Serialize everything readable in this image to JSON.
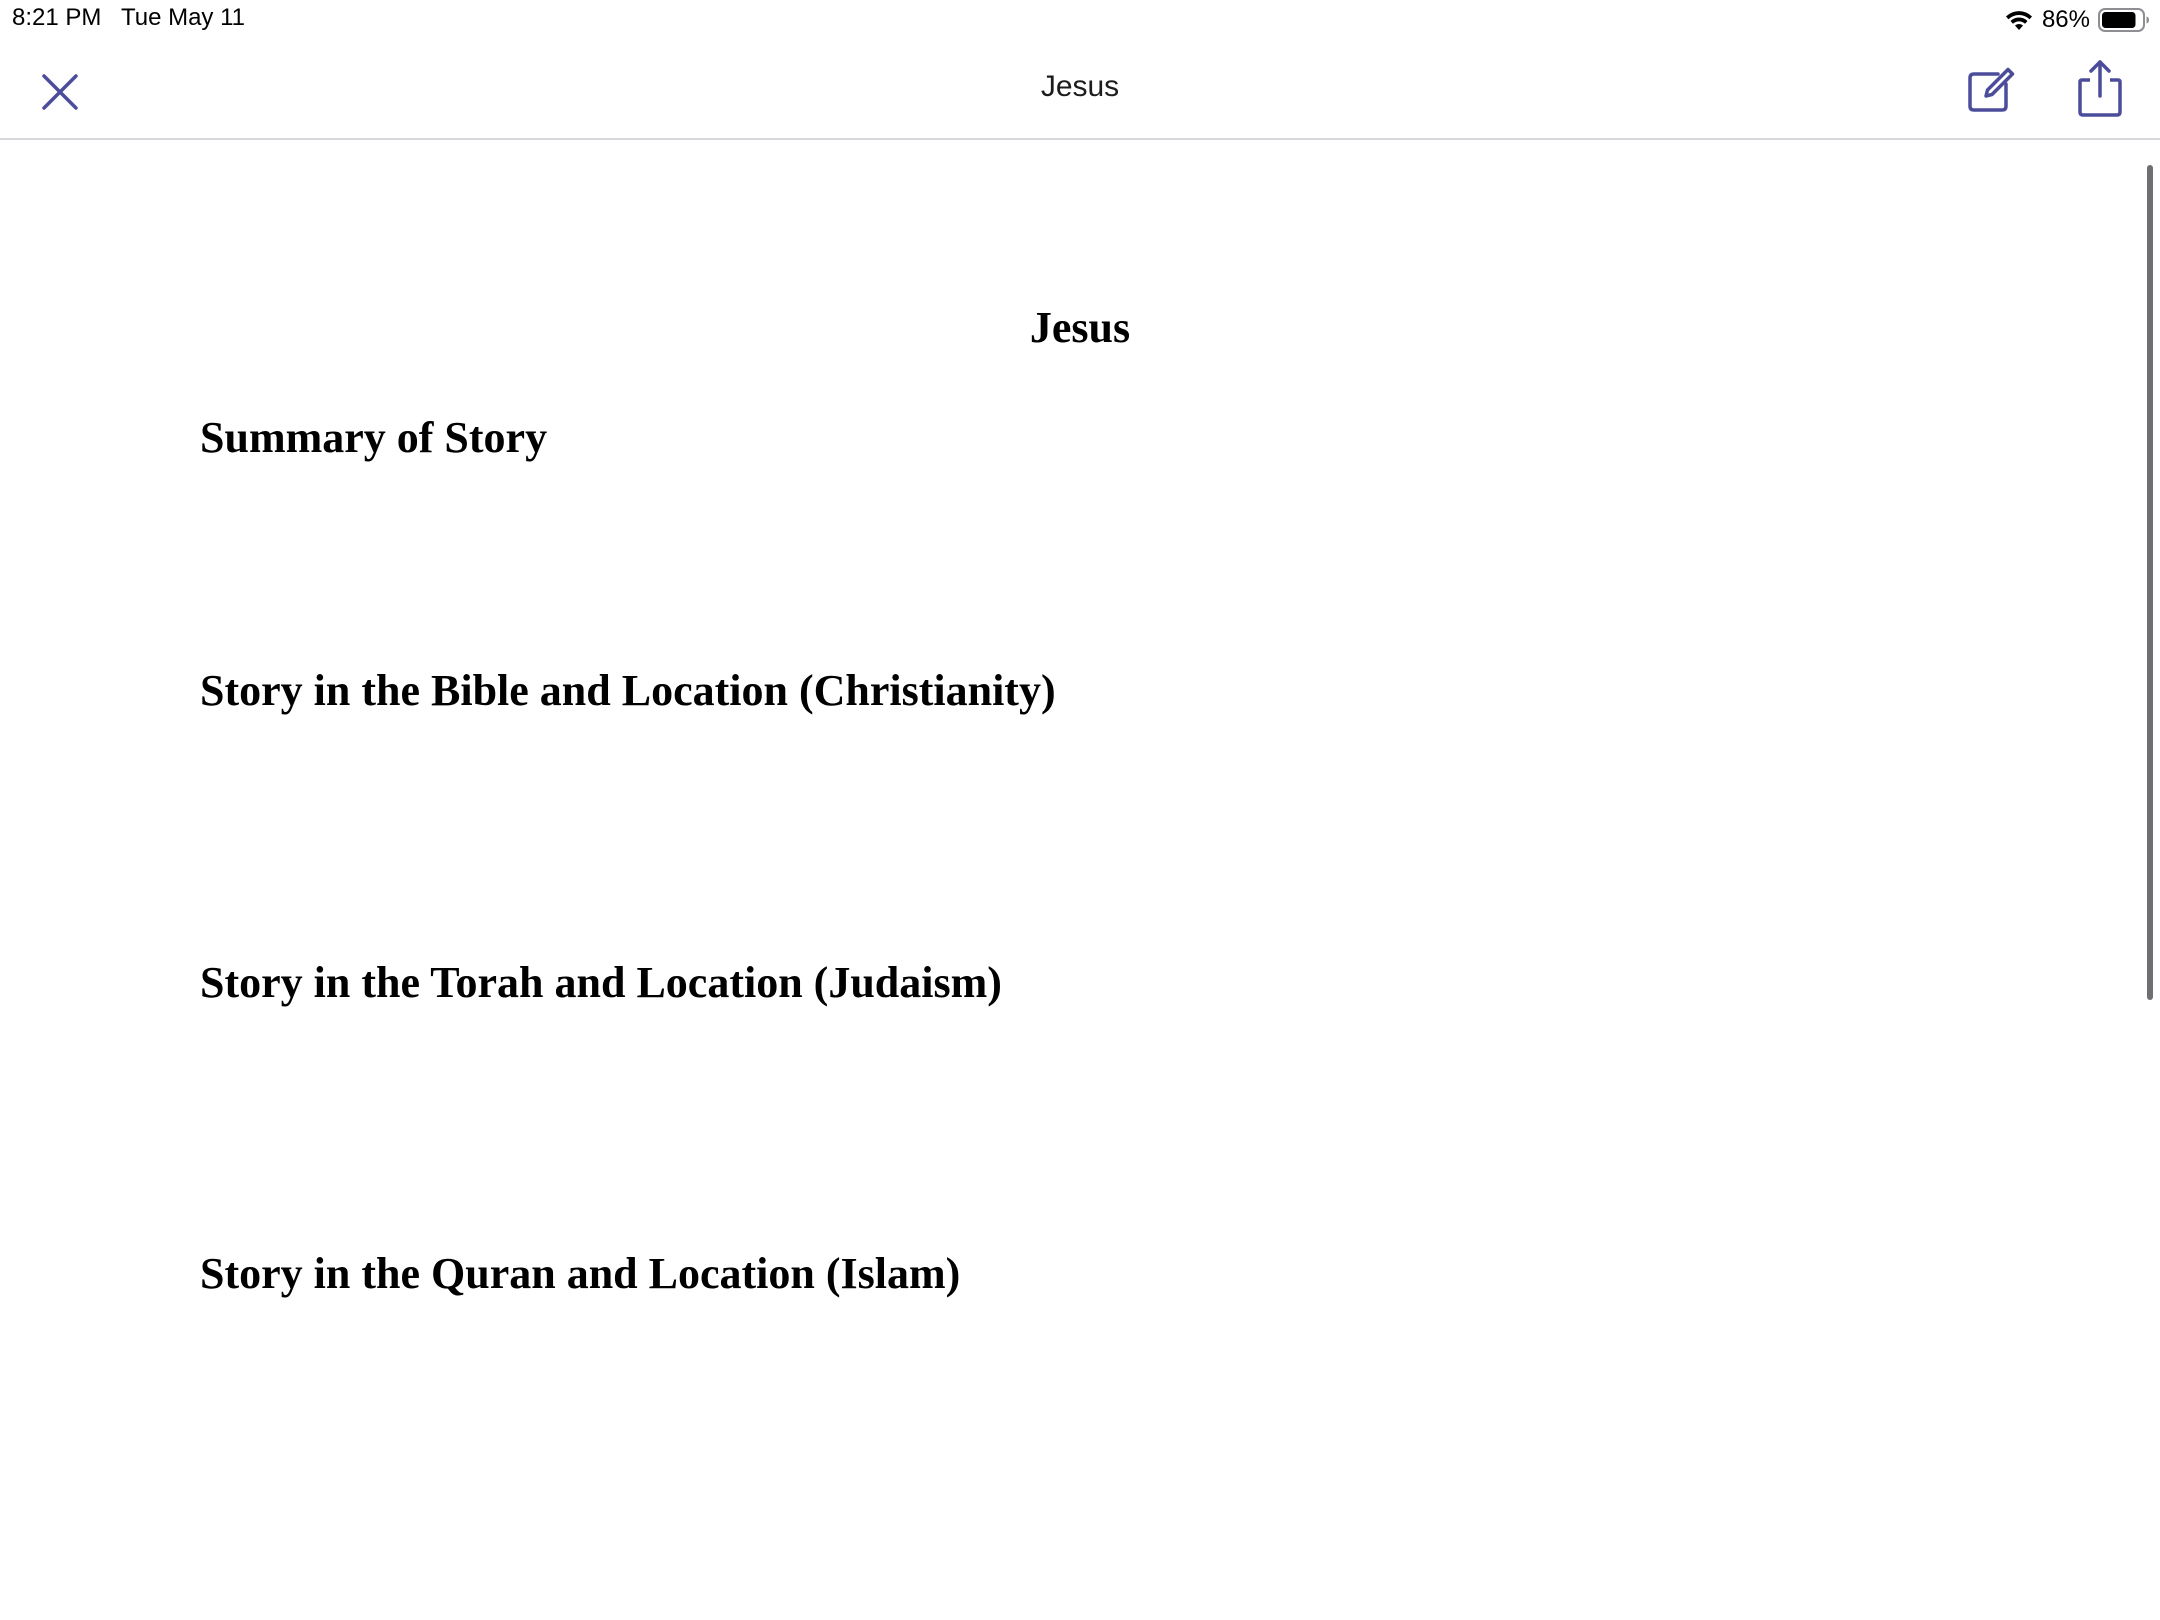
{
  "status_bar": {
    "time": "8:21 PM   Tue May 11",
    "battery_percent": "86%",
    "battery_level": 0.86
  },
  "nav": {
    "title": "Jesus",
    "accent_color": "#4b4d9a"
  },
  "document": {
    "title": "Jesus",
    "headings": [
      "Summary of Story",
      "Story in the Bible and Location (Christianity)",
      "Story in the Torah and Location (Judaism)",
      "Story in the Quran and Location (Islam)"
    ]
  },
  "icons": {
    "close": "close-icon",
    "edit": "compose-icon",
    "share": "share-icon",
    "wifi": "wifi-icon",
    "battery": "battery-icon"
  }
}
